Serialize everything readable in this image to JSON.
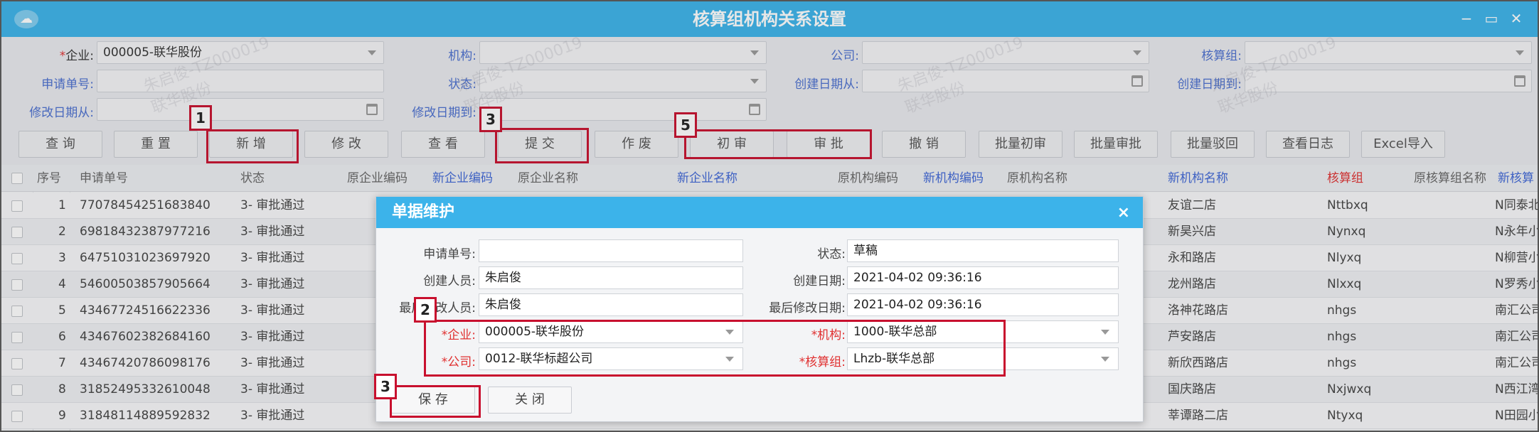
{
  "window": {
    "title": "核算组机构关系设置",
    "controls": [
      "−",
      "▭",
      "✕"
    ]
  },
  "filters": {
    "enterprise": {
      "label": "企业:",
      "required": "*",
      "value": "000005-联华股份"
    },
    "org": {
      "label": "机构:",
      "value": ""
    },
    "company": {
      "label": "公司:",
      "value": ""
    },
    "acct_group": {
      "label": "核算组:",
      "value": ""
    },
    "apply_no": {
      "label": "申请单号:",
      "value": ""
    },
    "status": {
      "label": "状态:",
      "value": ""
    },
    "create_from": {
      "label": "创建日期从:",
      "value": ""
    },
    "create_to": {
      "label": "创建日期到:",
      "value": ""
    },
    "modify_from": {
      "label": "修改日期从:",
      "value": ""
    },
    "modify_to": {
      "label": "修改日期到:",
      "value": ""
    }
  },
  "toolbar": {
    "query": "查 询",
    "reset": "重 置",
    "add": "新 增",
    "edit": "修 改",
    "view": "查 看",
    "submit": "提 交",
    "void": "作 废",
    "first_review": "初 审",
    "approve": "审 批",
    "revoke": "撤 销",
    "batch_first_review": "批量初审",
    "batch_approve": "批量审批",
    "batch_reject": "批量驳回",
    "view_log": "查看日志",
    "excel_import": "Excel导入"
  },
  "table": {
    "columns": {
      "seq": "序号",
      "apply_no": "申请单号",
      "status": "状态",
      "old_ent_code": "原企业编码",
      "new_ent_code": "新企业编码",
      "old_ent_name": "原企业名称",
      "new_ent_name": "新企业名称",
      "old_org_code": "原机构编码",
      "new_org_code": "新机构编码",
      "old_org_name": "原机构名称",
      "new_org_name": "新机构名称",
      "acct_group": "核算组",
      "old_acct_group_name": "原核算组名称",
      "new_acct_group": "新核算"
    },
    "rows": [
      {
        "seq": "1",
        "apply_no": "77078454251683840",
        "status": "3- 审批通过",
        "new_org_name": "友谊二店",
        "acct_group": "Nttbxq",
        "new_acct_group": "N同泰北"
      },
      {
        "seq": "2",
        "apply_no": "69818432387977216",
        "status": "3- 审批通过",
        "new_org_name": "新昊兴店",
        "acct_group": "Nynxq",
        "new_acct_group": "N永年小"
      },
      {
        "seq": "3",
        "apply_no": "64751031023697920",
        "status": "3- 审批通过",
        "new_org_name": "永和路店",
        "acct_group": "Nlyxq",
        "new_acct_group": "N柳营小"
      },
      {
        "seq": "4",
        "apply_no": "54600503857905664",
        "status": "3- 审批通过",
        "new_org_name": "龙州路店",
        "acct_group": "Nlxxq",
        "new_acct_group": "N罗秀小"
      },
      {
        "seq": "5",
        "apply_no": "43467724516622336",
        "status": "3- 审批通过",
        "new_org_name": "洛神花路店",
        "acct_group": "nhgs",
        "new_acct_group": "南汇公司"
      },
      {
        "seq": "6",
        "apply_no": "43467602382684160",
        "status": "3- 审批通过",
        "new_org_name": "芦安路店",
        "acct_group": "nhgs",
        "new_acct_group": "南汇公司"
      },
      {
        "seq": "7",
        "apply_no": "43467420786098176",
        "status": "3- 审批通过",
        "new_org_name": "新欣西路店",
        "acct_group": "nhgs",
        "new_acct_group": "南汇公司"
      },
      {
        "seq": "8",
        "apply_no": "31852495332610048",
        "status": "3- 审批通过",
        "new_org_name": "国庆路店",
        "acct_group": "Nxjwxq",
        "new_acct_group": "N西江湾"
      },
      {
        "seq": "9",
        "apply_no": "31848114889592832",
        "status": "3- 审批通过",
        "new_org_name": "莘谭路二店",
        "acct_group": "Ntyxq",
        "new_acct_group": "N田园小"
      }
    ]
  },
  "watermark": {
    "line1": "朱启俊-TZ000019",
    "line2": "联华股份"
  },
  "modal": {
    "title": "单据维护",
    "close": "×",
    "apply_no": {
      "label": "申请单号:",
      "value": ""
    },
    "status": {
      "label": "状态:",
      "value": "草稿"
    },
    "creator": {
      "label": "创建人员:",
      "value": "朱启俊"
    },
    "create_date": {
      "label": "创建日期:",
      "value": "2021-04-02 09:36:16"
    },
    "last_modifier": {
      "label": "最后修改人员:",
      "value": "朱启俊"
    },
    "last_modify_date": {
      "label": "最后修改日期:",
      "value": "2021-04-02 09:36:16"
    },
    "enterprise": {
      "label": "*企业:",
      "value": "000005-联华股份"
    },
    "org": {
      "label": "*机构:",
      "value": "1000-联华总部"
    },
    "company": {
      "label": "*公司:",
      "value": "0012-联华标超公司"
    },
    "acct_group": {
      "label": "*核算组:",
      "value": "Lhzb-联华总部"
    },
    "save": "保 存",
    "close_btn": "关 闭"
  },
  "annotations": [
    "1",
    "2",
    "3",
    "3",
    "5"
  ],
  "colors": {
    "accent": "#3cb3ea",
    "annotation": "#c8102e",
    "link_label": "#4a6fd0"
  }
}
